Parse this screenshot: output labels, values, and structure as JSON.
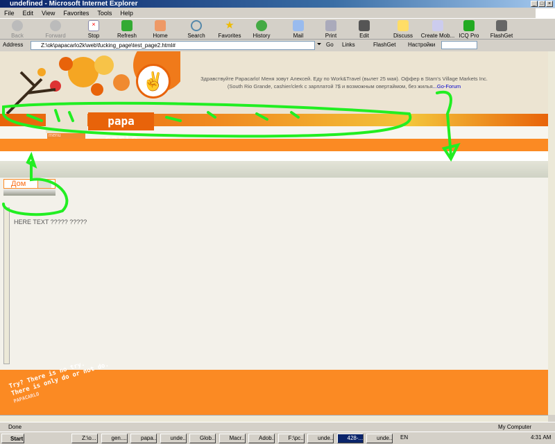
{
  "window": {
    "title": "undefined - Microsoft Internet Explorer"
  },
  "menu": [
    "File",
    "Edit",
    "View",
    "Favorites",
    "Tools",
    "Help"
  ],
  "toolbar": [
    {
      "label": "Back",
      "disabled": true
    },
    {
      "label": "Forward",
      "disabled": true
    },
    {
      "label": "Stop"
    },
    {
      "label": "Refresh"
    },
    {
      "label": "Home"
    },
    {
      "label": "Search"
    },
    {
      "label": "Favorites"
    },
    {
      "label": "History"
    },
    {
      "label": "Mail"
    },
    {
      "label": "Print"
    },
    {
      "label": "Edit"
    },
    {
      "label": "Discuss"
    },
    {
      "label": "Create Mob..."
    },
    {
      "label": "ICQ Pro"
    },
    {
      "label": "FlashGet"
    }
  ],
  "address": {
    "label": "Address",
    "url": "Z:\\ok\\papacarlo2k\\web\\fucking_page\\test_page2.html#",
    "go": "Go",
    "links": "Links",
    "flashget": "FlashGet",
    "settings": "Настройки"
  },
  "page": {
    "greeting": "Здравствуйте Papacarlo! Меня зовут Алексей. Еду по Work&Travel (вылет 25 мая). Оффер в Stam's Village Markets Inc. (South Rio Grande, cashier/clerk с зарплатой 7$ и возможным овертаймом, без жилья",
    "forum_link": "...Go-Forum",
    "logo": "papa carlo",
    "menu_label": "menu",
    "tab_home": "Дом",
    "body_text": "HERE TEXT ????? ?????",
    "footer_quote_1": "Try? There is no try.",
    "footer_quote_2": "There is only do or not do.",
    "footer_sign": "PAPACARLO"
  },
  "status": {
    "text": "Done",
    "zone": "My Computer"
  },
  "taskbar": {
    "start": "Start",
    "tasks": [
      "Z:\\o...",
      "gen....",
      "papa...",
      "unde...",
      "Glob...",
      "Macr...",
      "Adob...",
      "F:\\pc...",
      "unde...",
      "428-...",
      "unde..."
    ],
    "lang": "EN",
    "clock": "4:31 AM"
  },
  "colors": {
    "orange": "#fb8a23",
    "dark_orange": "#e8630a",
    "scribble": "#22ee22"
  }
}
